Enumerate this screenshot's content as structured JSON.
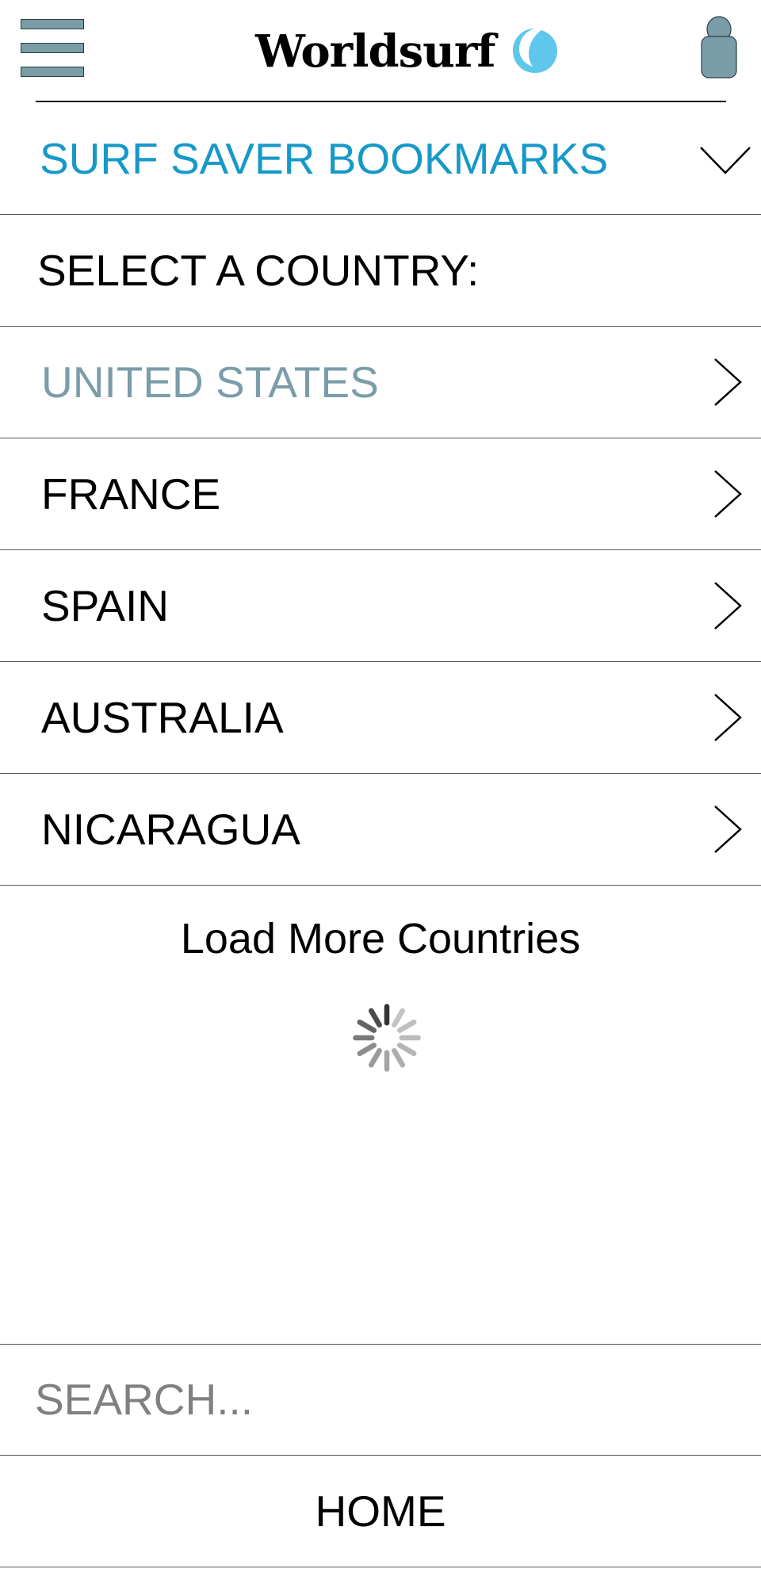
{
  "header": {
    "logo_text": "Worldsurf",
    "menu_icon": "hamburger-icon",
    "logo_icon": "wave-icon",
    "profile_icon": "user-icon",
    "accent_color": "#7a9da8",
    "wave_color": "#5fc6ec"
  },
  "bookmarks": {
    "label": "SURF SAVER BOOKMARKS",
    "color": "#1699c8",
    "icon": "chevron-down-icon"
  },
  "country_select": {
    "heading": "SELECT A COUNTRY:",
    "countries": [
      {
        "label": "UNITED STATES",
        "selected": true
      },
      {
        "label": "FRANCE",
        "selected": false
      },
      {
        "label": "SPAIN",
        "selected": false
      },
      {
        "label": "AUSTRALIA",
        "selected": false
      },
      {
        "label": "NICARAGUA",
        "selected": false
      }
    ],
    "item_icon": "chevron-right-icon",
    "load_more_label": "Load More Countries",
    "loading_icon": "spinner-icon"
  },
  "search": {
    "placeholder": "SEARCH...",
    "value": ""
  },
  "footer": {
    "home_label": "HOME"
  }
}
